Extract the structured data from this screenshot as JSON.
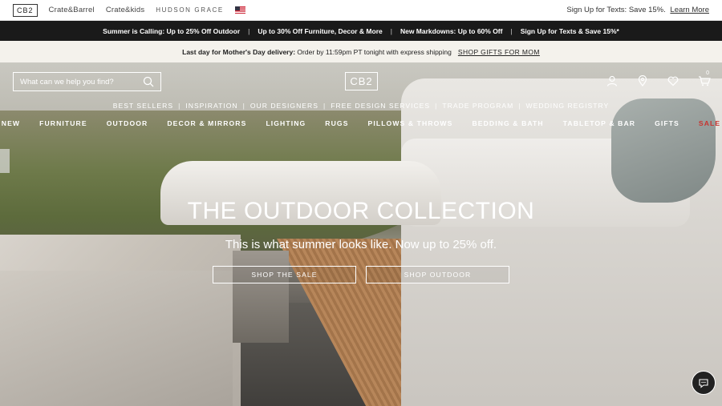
{
  "top_bar": {
    "brands": [
      "CB2",
      "Crate&Barrel",
      "Crate&kids",
      "HUDSON GRACE"
    ],
    "flag_icon": "us-flag-icon",
    "signup_text": "Sign Up for Texts: Save 15%.",
    "signup_link": "Learn More"
  },
  "promo_bar": {
    "items": [
      "Summer is Calling: Up to 25% Off Outdoor",
      "Up to 30% Off Furniture, Decor & More",
      "New Markdowns: Up to 60% Off",
      "Sign Up for Texts & Save 15%*"
    ],
    "separator": "|"
  },
  "delivery_bar": {
    "bold_text": "Last day for Mother's Day delivery:",
    "text": "Order by 11:59pm PT tonight with express shipping",
    "link": "SHOP GIFTS FOR MOM"
  },
  "header": {
    "search_placeholder": "What can we help you find?",
    "logo": "CB2",
    "icons": [
      "account-icon",
      "location-icon",
      "heart-icon",
      "cart-icon"
    ],
    "cart_count": "0"
  },
  "subnav": {
    "items": [
      "BEST SELLERS",
      "INSPIRATION",
      "OUR DESIGNERS",
      "FREE DESIGN SERVICES",
      "TRADE PROGRAM",
      "WEDDING REGISTRY"
    ],
    "separator": "|"
  },
  "mainnav": {
    "items": [
      "NEW",
      "FURNITURE",
      "OUTDOOR",
      "DECOR & MIRRORS",
      "LIGHTING",
      "RUGS",
      "PILLOWS & THROWS",
      "BEDDING & BATH",
      "TABLETOP & BAR",
      "GIFTS",
      "SALE"
    ],
    "sale_color": "#c8332f"
  },
  "hero": {
    "headline": "THE OUTDOOR COLLECTION",
    "subhead": "This is what summer looks like. Now up to 25% off.",
    "cta_primary": "SHOP THE SALE",
    "cta_secondary": "SHOP OUTDOOR"
  },
  "chat": {
    "icon": "chat-icon"
  }
}
